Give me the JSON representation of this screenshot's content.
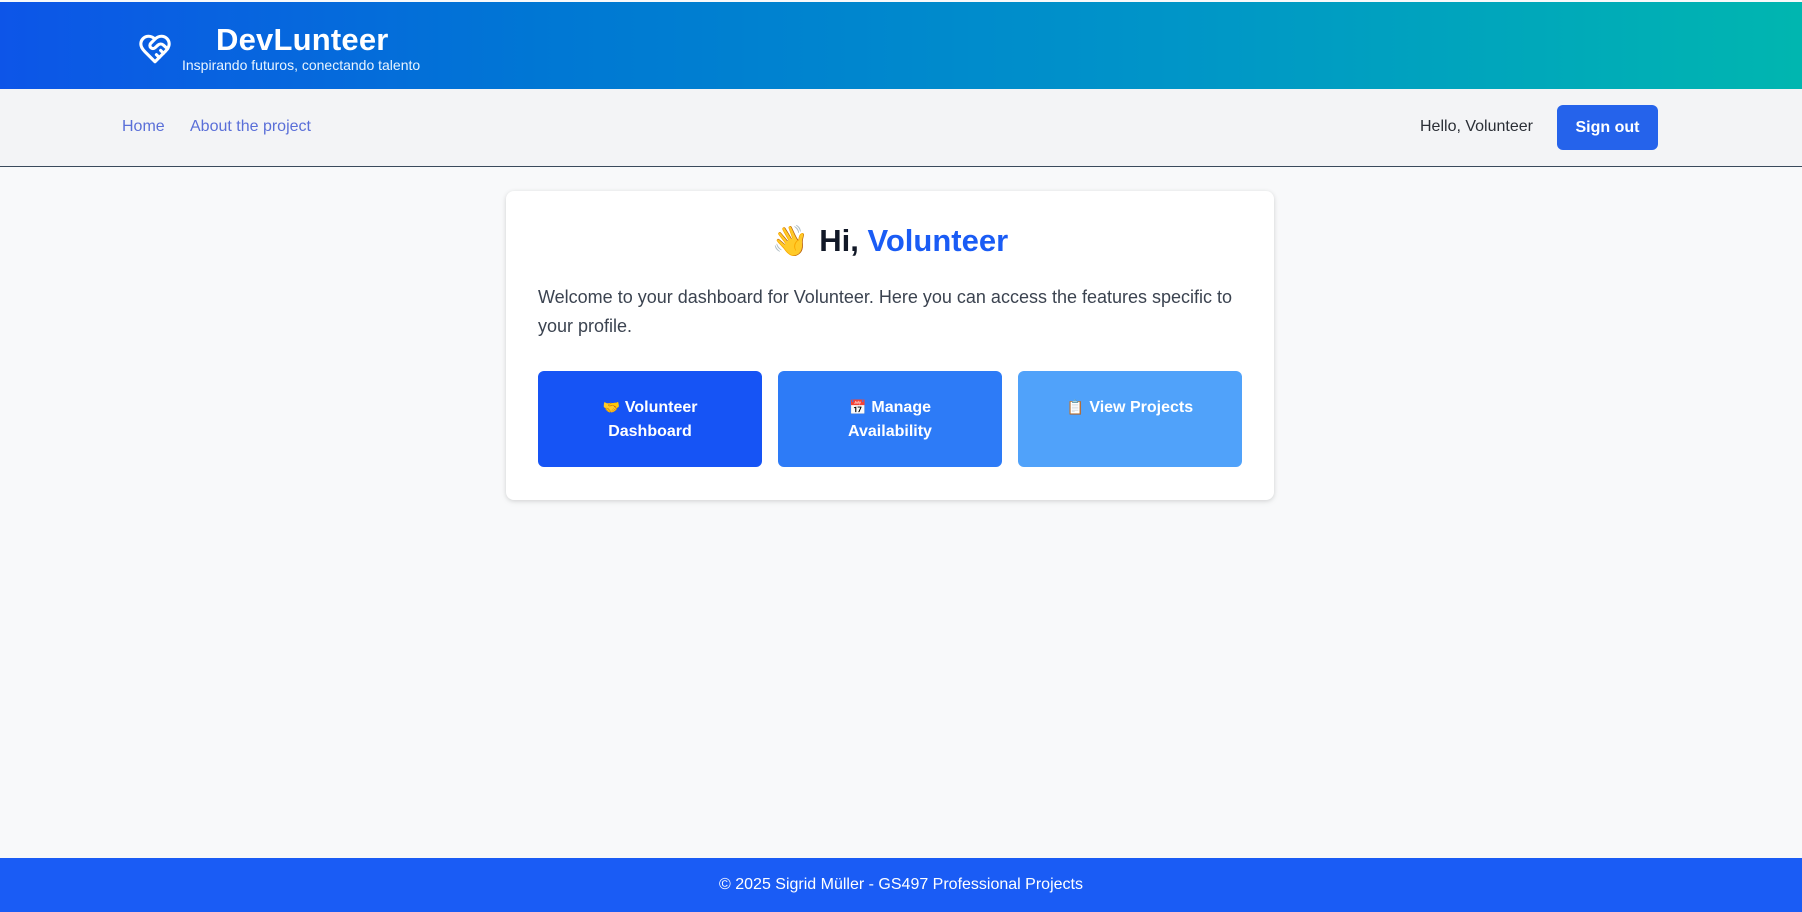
{
  "header": {
    "title": "DevLunteer",
    "subtitle": "Inspirando futuros, conectando talento",
    "logo_icon": "heart-handshake-icon"
  },
  "nav": {
    "links": [
      {
        "label": "Home"
      },
      {
        "label": "About the project"
      }
    ],
    "greeting": "Hello, Volunteer",
    "signout_label": "Sign out"
  },
  "card": {
    "wave_emoji": "👋",
    "title_prefix": "Hi,",
    "title_name": "Volunteer",
    "description": "Welcome to your dashboard for Volunteer. Here you can access the features specific to your profile.",
    "actions": [
      {
        "icon": "🤝",
        "label": "Volunteer Dashboard",
        "color": "#1654f5"
      },
      {
        "icon": "📅",
        "label": "Manage Availability",
        "color": "#2d7bf7"
      },
      {
        "icon": "📋",
        "label": "View Projects",
        "color": "#50a2fa"
      }
    ]
  },
  "footer": {
    "text": "© 2025 Sigrid Müller - GS497 Professional Projects"
  },
  "colors": {
    "accent": "#1a5cf5",
    "signout_button": "#2563eb",
    "nav_link": "#5a6fd8"
  }
}
